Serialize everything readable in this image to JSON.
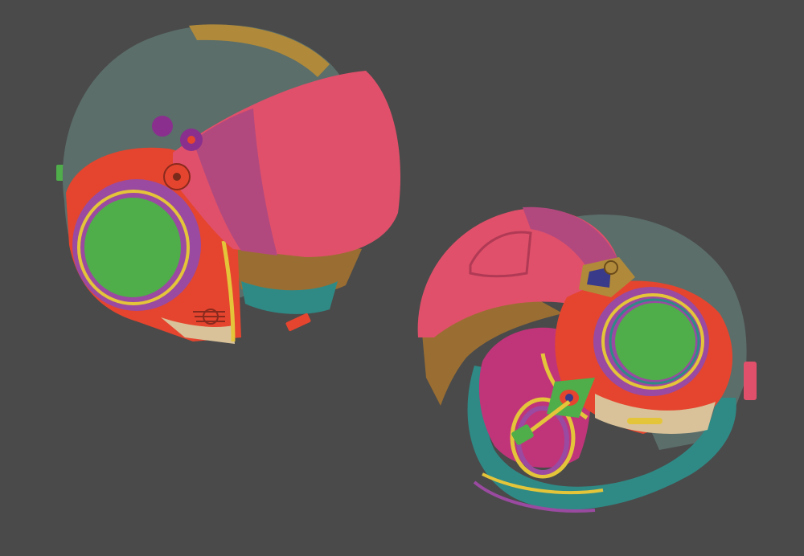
{
  "scene": {
    "background_color": "#4a4a4a",
    "subject": "two-helmet-render",
    "palette": {
      "shell_gray": "#5b6e6a",
      "shell_gold": "#b08a3a",
      "visor_pink": "#e0506a",
      "visor_magenta": "#b2497e",
      "frame_red": "#e5452e",
      "ring_purple": "#9a4aa0",
      "lens_green": "#4fae4a",
      "trim_yellow": "#e4c53a",
      "pad_teal": "#2f8a86",
      "liner_brown": "#9a6e32",
      "inner_tan": "#d9c29a",
      "stud_purple": "#8a2f8e",
      "dark_blue": "#3a3a8a"
    }
  }
}
